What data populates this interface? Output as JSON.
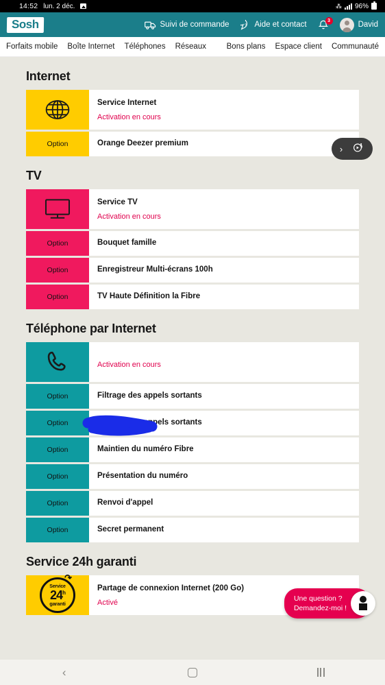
{
  "statusbar": {
    "time": "14:52",
    "date": "lun. 2 déc.",
    "image_icon": "image-icon",
    "network_glyph": "⁂",
    "battery_pct": "96%"
  },
  "header": {
    "logo": "Sosh",
    "order_tracking": "Suivi de commande",
    "help": "Aide et contact",
    "notification_count": "3",
    "user": "David",
    "bg_color": "#1b7e8a"
  },
  "nav": {
    "items": [
      "Forfaits mobile",
      "Boîte Internet",
      "Téléphones",
      "Réseaux",
      "Bons plans",
      "Espace client",
      "Communauté"
    ]
  },
  "assistant_pill": {
    "chevron": "›",
    "icon": "assistant-orb-icon"
  },
  "sections": [
    {
      "title": "Internet",
      "color": "#ffcc00",
      "tile_class": "t-yellow",
      "main": {
        "icon": "globe-icon",
        "title": "Service Internet",
        "status": "Activation en cours"
      },
      "options": [
        {
          "tile": "Option",
          "title": "Orange Deezer premium"
        }
      ]
    },
    {
      "title": "TV",
      "color": "#f0195e",
      "tile_class": "t-pink",
      "main": {
        "icon": "tv-icon",
        "title": "Service TV",
        "status": "Activation en cours"
      },
      "options": [
        {
          "tile": "Option",
          "title": "Bouquet famille"
        },
        {
          "tile": "Option",
          "title": "Enregistreur Multi-écrans 100h"
        },
        {
          "tile": "Option",
          "title": "TV Haute Définition la Fibre"
        }
      ]
    },
    {
      "title": "Téléphone par Internet",
      "color": "#0e9ba0",
      "tile_class": "t-teal",
      "main": {
        "icon": "phone-icon",
        "title": "",
        "status": "Activation en cours",
        "redacted": true
      },
      "options": [
        {
          "tile": "Option",
          "title": "Filtrage des appels sortants"
        },
        {
          "tile": "Option",
          "title": "Filtrage des appels sortants"
        },
        {
          "tile": "Option",
          "title": "Maintien du numéro Fibre"
        },
        {
          "tile": "Option",
          "title": "Présentation du numéro"
        },
        {
          "tile": "Option",
          "title": "Renvoi d'appel"
        },
        {
          "tile": "Option",
          "title": "Secret permanent"
        }
      ]
    },
    {
      "title": "Service 24h garanti",
      "color": "#ffcc00",
      "tile_class": "t-yellow",
      "main": {
        "icon": "service-24h-badge-icon",
        "badge_top": "Service",
        "badge_num": "24",
        "badge_sup": "h",
        "badge_bottom": "garanti",
        "title": "Partage de connexion Internet (200 Go)",
        "status": "Activé"
      },
      "options": []
    }
  ],
  "chat": {
    "line1": "Une question ?",
    "line2": "Demandez-moi !",
    "color": "#e5004f"
  },
  "annotation": {
    "type": "scribble",
    "color": "#1a2ce8"
  },
  "bottom_nav": {
    "back": "‹",
    "home": "home-icon",
    "recents": "recents-icon"
  }
}
